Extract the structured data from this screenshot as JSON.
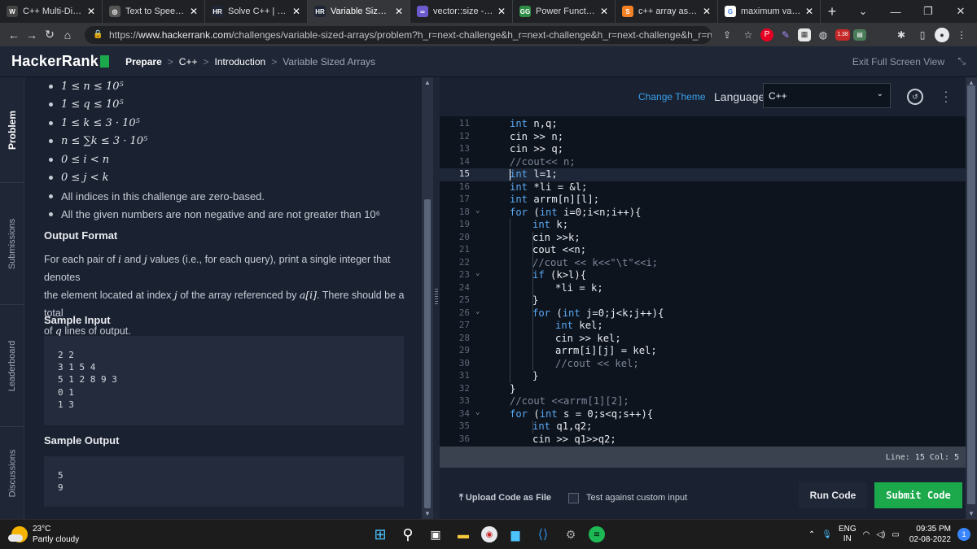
{
  "browser": {
    "tabs": [
      {
        "label": "C++ Multi-Dimen",
        "favicon": "W",
        "color": "#444",
        "active": false
      },
      {
        "label": "Text to Speech in",
        "favicon": "◎",
        "color": "#555",
        "active": false
      },
      {
        "label": "Solve C++ | Hack",
        "favicon": "HR",
        "color": "#1f2636",
        "active": false
      },
      {
        "label": "Variable Sized Ar",
        "favicon": "HR",
        "color": "#1f2636",
        "active": true
      },
      {
        "label": "vector::size - C++",
        "favicon": "∞",
        "color": "#6a5acd",
        "active": false
      },
      {
        "label": "Power Function in",
        "favicon": "GG",
        "color": "#2f8d46",
        "active": false
      },
      {
        "label": "c++ array assignm",
        "favicon": "S",
        "color": "#f48024",
        "active": false
      },
      {
        "label": "maximum value c",
        "favicon": "G",
        "color": "#ffffff",
        "active": false
      }
    ],
    "new_tab": "+",
    "url_prefix": "https://",
    "url_host": "www.hackerrank.com",
    "url_path": "/challenges/variable-sized-arrays/problem?h_r=next-challenge&h_r=next-challenge&h_r=next-challenge&h_r=next-cha..."
  },
  "header": {
    "logo": "HackerRank",
    "breadcrumb": [
      "Prepare",
      "C++",
      "Introduction",
      "Variable Sized Arrays"
    ],
    "exit_fullscreen": "Exit Full Screen View"
  },
  "rail": {
    "problem": "Problem",
    "submissions": "Submissions",
    "leaderboard": "Leaderboard",
    "discussions": "Discussions"
  },
  "problem": {
    "constraints": [
      "1 ≤ n ≤ 10⁵",
      "1 ≤ q ≤ 10⁵",
      "1 ≤ k ≤ 3 · 10⁵",
      "n ≤ ∑k ≤ 3 · 10⁵",
      "0 ≤ i < n",
      "0 ≤ j < k"
    ],
    "notes": [
      "All indices in this challenge are zero-based.",
      "All the given numbers are non negative and are not greater than 10⁶"
    ],
    "output_format_title": "Output Format",
    "output_format_line1_a": "For each pair of ",
    "output_format_i": "i",
    "output_format_line1_b": " and ",
    "output_format_j": "j",
    "output_format_line1_c": " values (i.e., for each query), print a single integer that denotes",
    "output_format_line2_a": "the element located at index ",
    "output_format_j2": "j",
    "output_format_line2_b": " of the array referenced by ",
    "output_format_ai": "a[i]",
    "output_format_line2_c": ". There should be a total",
    "output_format_line3_a": "of ",
    "output_format_q": "q",
    "output_format_line3_b": " lines of output.",
    "sample_input_title": "Sample Input",
    "sample_input": "2 2\n3 1 5 4\n5 1 2 8 9 3\n0 1\n1 3",
    "sample_output_title": "Sample Output",
    "sample_output": "5\n9"
  },
  "editor": {
    "change_theme": "Change Theme",
    "language_label": "Language",
    "language_value": "C++",
    "status": "Line: 15 Col: 5",
    "upload": "Upload Code as File",
    "test_custom": "Test against custom input",
    "run": "Run Code",
    "submit": "Submit Code",
    "lines": [
      {
        "n": "11",
        "code": "int n,q;",
        "ind": 0
      },
      {
        "n": "12",
        "code": "cin >> n;",
        "ind": 0
      },
      {
        "n": "13",
        "code": "cin >> q;",
        "ind": 0
      },
      {
        "n": "14",
        "code": "//cout<< n;",
        "ind": 0
      },
      {
        "n": "15",
        "code": "int l=1;",
        "ind": 0,
        "cur": true
      },
      {
        "n": "16",
        "code": "int *li = &l;",
        "ind": 0
      },
      {
        "n": "17",
        "code": "int arrm[n][l];",
        "ind": 0
      },
      {
        "n": "18",
        "code": "for (int i=0;i<n;i++){",
        "ind": 0,
        "fold": true
      },
      {
        "n": "19",
        "code": "int k;",
        "ind": 1
      },
      {
        "n": "20",
        "code": "cin >>k;",
        "ind": 1
      },
      {
        "n": "21",
        "code": "cout <<n;",
        "ind": 1
      },
      {
        "n": "22",
        "code": "//cout << k<<\"\\t\"<<i;",
        "ind": 1
      },
      {
        "n": "23",
        "code": "if (k>l){",
        "ind": 1,
        "fold": true
      },
      {
        "n": "24",
        "code": "*li = k;",
        "ind": 2
      },
      {
        "n": "25",
        "code": "}",
        "ind": 1
      },
      {
        "n": "26",
        "code": "for (int j=0;j<k;j++){",
        "ind": 1,
        "fold": true
      },
      {
        "n": "27",
        "code": "int kel;",
        "ind": 2
      },
      {
        "n": "28",
        "code": "cin >> kel;",
        "ind": 2
      },
      {
        "n": "29",
        "code": "arrm[i][j] = kel;",
        "ind": 2
      },
      {
        "n": "30",
        "code": "//cout << kel;",
        "ind": 2
      },
      {
        "n": "31",
        "code": "}",
        "ind": 1
      },
      {
        "n": "32",
        "code": "}",
        "ind": 0
      },
      {
        "n": "33",
        "code": "//cout <<arrm[1][2];",
        "ind": 0
      },
      {
        "n": "34",
        "code": "for (int s = 0;s<q;s++){",
        "ind": 0,
        "fold": true
      },
      {
        "n": "35",
        "code": "int q1,q2;",
        "ind": 1
      },
      {
        "n": "36",
        "code": "cin >> q1>>q2;",
        "ind": 1
      }
    ]
  },
  "taskbar": {
    "temp": "23°C",
    "weather": "Partly cloudy",
    "lang1": "ENG",
    "lang2": "IN",
    "time": "09:35 PM",
    "date": "02-08-2022",
    "notifications": "1"
  }
}
